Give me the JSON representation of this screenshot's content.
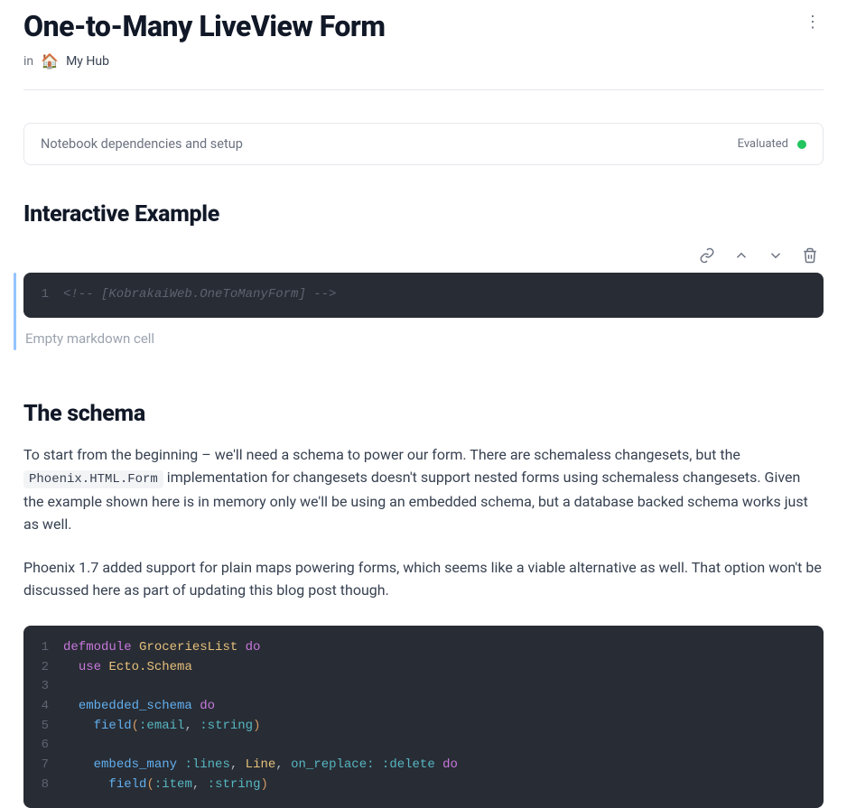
{
  "header": {
    "title": "One-to-Many LiveView Form",
    "in_label": "in",
    "hub_emoji": "🏠",
    "hub_name": "My Hub"
  },
  "setup": {
    "label": "Notebook dependencies and setup",
    "status_text": "Evaluated",
    "status_color": "#22c55e"
  },
  "section1": {
    "heading": "Interactive Example",
    "code_lines": [
      {
        "n": "1",
        "content_html": "<span class=\"cm-comment\">&lt;!-- [KobrakaiWeb.OneToManyForm] --&gt;</span>"
      }
    ],
    "empty_md": "Empty markdown cell"
  },
  "section2": {
    "heading": "The schema",
    "para1_a": "To start from the beginning – we'll need a schema to power our form. There are schemaless changesets, but the ",
    "para1_code": "Phoenix.HTML.Form",
    "para1_b": " implementation for changesets doesn't support nested forms using schemaless changesets. Given the example shown here is in memory only we'll be using an embedded schema, but a database backed schema works just as well.",
    "para2": "Phoenix 1.7 added support for plain maps powering forms, which seems like a viable alternative as well. That option won't be discussed here as part of updating this blog post though.",
    "code_lines": [
      {
        "n": "1",
        "content_html": "<span class=\"cm-keyword\">defmodule</span> <span class=\"cm-module\">GroceriesList</span> <span class=\"cm-keyword\">do</span>"
      },
      {
        "n": "2",
        "content_html": "  <span class=\"cm-keyword\">use</span> <span class=\"cm-module\">Ecto.Schema</span>"
      },
      {
        "n": "3",
        "content_html": ""
      },
      {
        "n": "4",
        "content_html": "  <span class=\"cm-func\">embedded_schema</span> <span class=\"cm-keyword\">do</span>"
      },
      {
        "n": "5",
        "content_html": "    <span class=\"cm-func\">field</span><span class=\"cm-punct\">(</span><span class=\"cm-atom\">:email</span><span class=\"cm-op\">, </span><span class=\"cm-atom\">:string</span><span class=\"cm-punct\">)</span>"
      },
      {
        "n": "6",
        "content_html": ""
      },
      {
        "n": "7",
        "content_html": "    <span class=\"cm-func\">embeds_many</span> <span class=\"cm-atom\">:lines</span><span class=\"cm-op\">, </span><span class=\"cm-type\">Line</span><span class=\"cm-op\">, </span><span class=\"cm-atom\">on_replace:</span> <span class=\"cm-atom\">:delete</span> <span class=\"cm-keyword\">do</span>"
      },
      {
        "n": "8",
        "content_html": "      <span class=\"cm-func\">field</span><span class=\"cm-punct\">(</span><span class=\"cm-atom\">:item</span><span class=\"cm-op\">, </span><span class=\"cm-atom\">:string</span><span class=\"cm-punct\">)</span>"
      }
    ]
  }
}
